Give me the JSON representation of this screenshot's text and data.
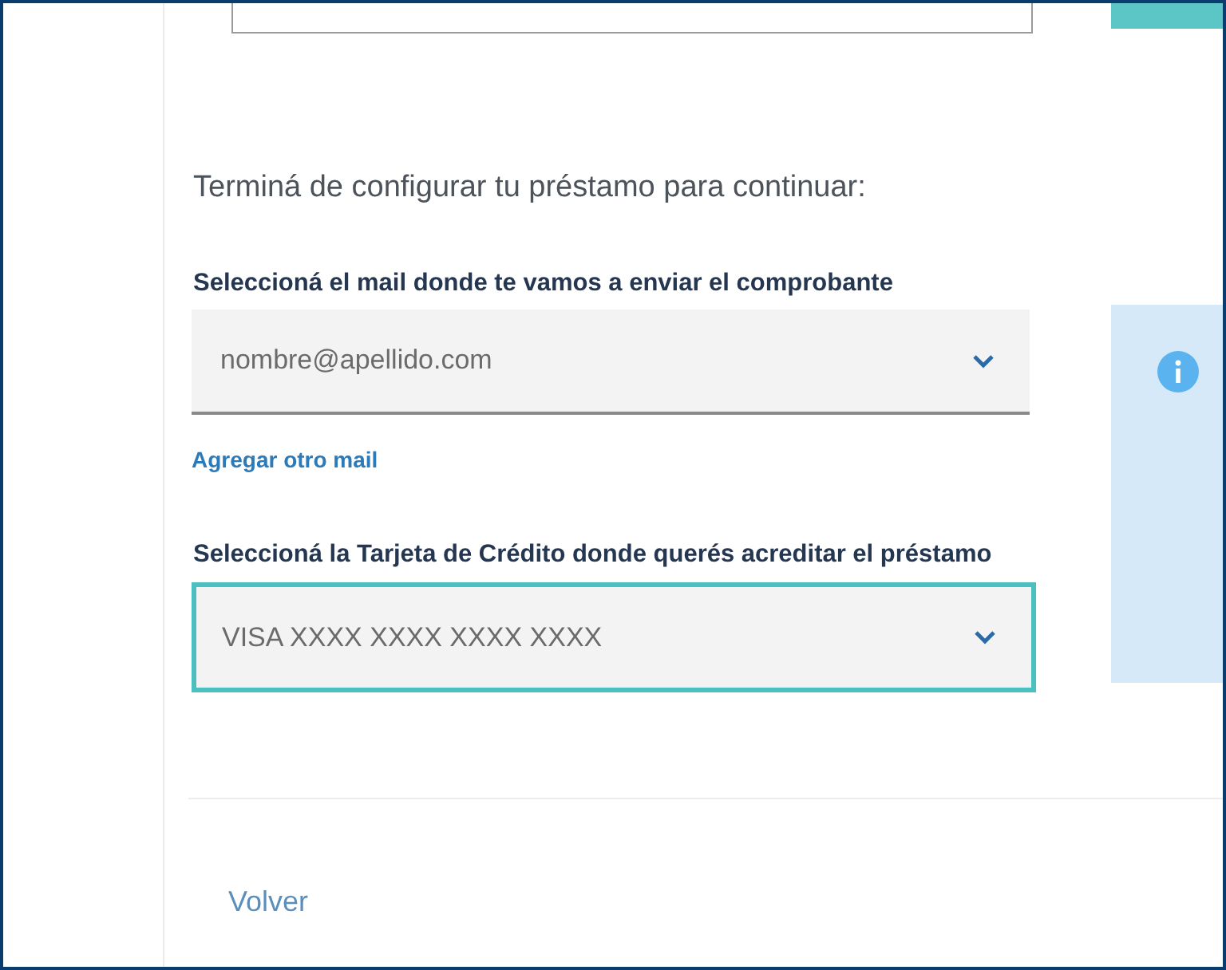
{
  "heading": "Terminá de configurar tu préstamo para continuar:",
  "email_field": {
    "label": "Seleccioná el mail donde te vamos a enviar el comprobante",
    "value": "nombre@apellido.com",
    "focused": false
  },
  "add_email_link": "Agregar otro mail",
  "card_field": {
    "label": "Seleccioná la Tarjeta de Crédito donde querés acreditar el préstamo",
    "value": "VISA XXXX XXXX XXXX XXXX",
    "focused": true
  },
  "back_link": "Volver"
}
